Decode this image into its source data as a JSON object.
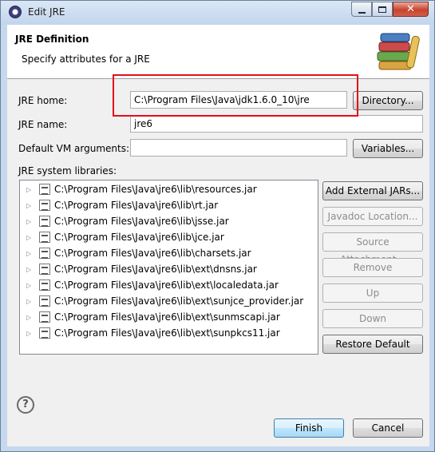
{
  "window": {
    "title": "Edit JRE"
  },
  "banner": {
    "title": "JRE Definition",
    "description": "Specify attributes for a JRE",
    "icon": "library-books-icon"
  },
  "form": {
    "jre_home_label": "JRE home:",
    "jre_home_value": "C:\\Program Files\\Java\\jdk1.6.0_10\\jre",
    "directory_button": "Directory...",
    "jre_name_label": "JRE name:",
    "jre_name_value": "jre6",
    "vm_args_label": "Default VM arguments:",
    "vm_args_value": "",
    "variables_button": "Variables...",
    "system_libraries_label": "JRE system libraries:"
  },
  "libraries": [
    "C:\\Program Files\\Java\\jre6\\lib\\resources.jar",
    "C:\\Program Files\\Java\\jre6\\lib\\rt.jar",
    "C:\\Program Files\\Java\\jre6\\lib\\jsse.jar",
    "C:\\Program Files\\Java\\jre6\\lib\\jce.jar",
    "C:\\Program Files\\Java\\jre6\\lib\\charsets.jar",
    "C:\\Program Files\\Java\\jre6\\lib\\ext\\dnsns.jar",
    "C:\\Program Files\\Java\\jre6\\lib\\ext\\localedata.jar",
    "C:\\Program Files\\Java\\jre6\\lib\\ext\\sunjce_provider.jar",
    "C:\\Program Files\\Java\\jre6\\lib\\ext\\sunmscapi.jar",
    "C:\\Program Files\\Java\\jre6\\lib\\ext\\sunpkcs11.jar"
  ],
  "side_buttons": {
    "add_external": "Add External JARs...",
    "javadoc": "Javadoc Location...",
    "source": "Source Attachment...",
    "remove": "Remove",
    "up": "Up",
    "down": "Down",
    "restore": "Restore Default"
  },
  "footer": {
    "help": "?",
    "finish": "Finish",
    "cancel": "Cancel"
  },
  "colors": {
    "highlight": "#e0101a",
    "title_bar": "#c5d8ee"
  }
}
